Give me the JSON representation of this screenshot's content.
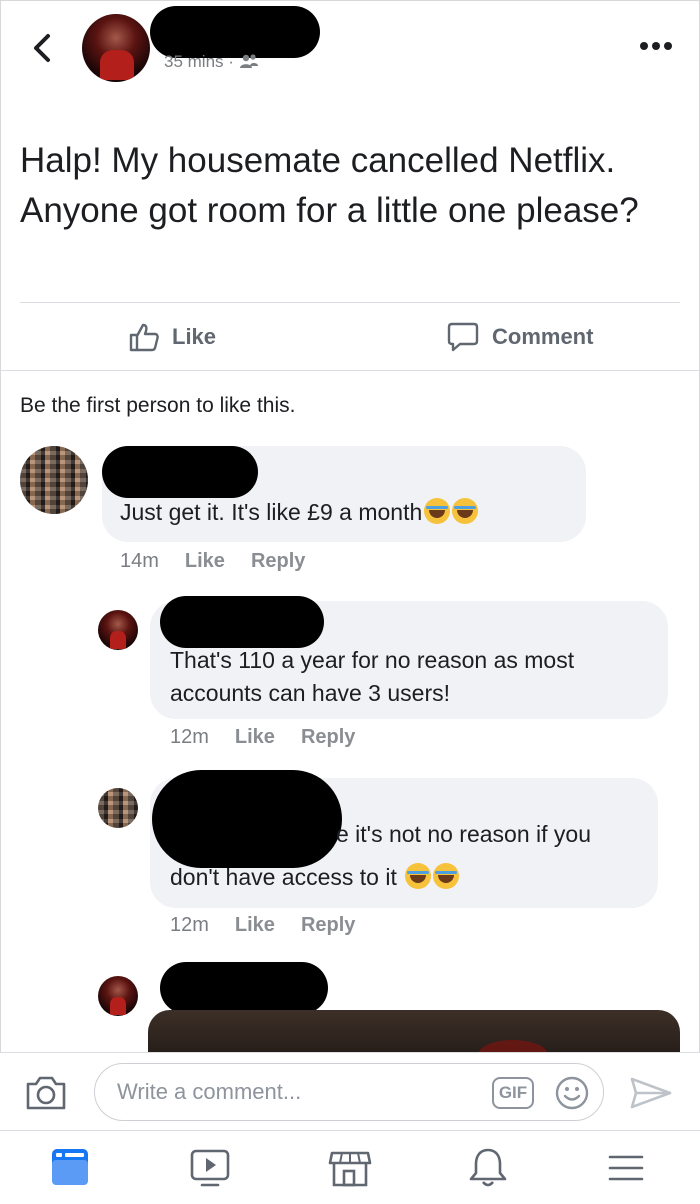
{
  "header": {
    "post_time": "35 mins",
    "meta_separator": "·",
    "audience_icon": "friends-icon",
    "back_icon": "chevron-left-icon",
    "more_icon": "ellipsis-icon"
  },
  "post": {
    "text": "Halp! My housemate cancelled Netflix. Anyone got room for a little one please?"
  },
  "actions": {
    "like_label": "Like",
    "comment_label": "Comment"
  },
  "reactions_summary": "Be the first person to like this.",
  "comments": [
    {
      "text": "Just get it. It's like £9 a month",
      "time": "14m",
      "like_label": "Like",
      "reply_label": "Reply"
    },
    {
      "text_line1": "That's 110 a year for no reason as most",
      "text_line2": "accounts can have 3 users!",
      "time": "12m",
      "like_label": "Like",
      "reply_label": "Reply"
    },
    {
      "text_line1": "e it's not no reason if you",
      "text_line2": "don't have access to it",
      "time": "12m",
      "like_label": "Like",
      "reply_label": "Reply"
    }
  ],
  "composer": {
    "placeholder": "Write a comment...",
    "gif_label": "GIF"
  },
  "nav": {
    "items": [
      "feed-icon",
      "watch-icon",
      "marketplace-icon",
      "notifications-icon",
      "menu-icon"
    ]
  },
  "colors": {
    "accent_blue": "#1877f2",
    "bubble_bg": "#f0f2f5",
    "muted_text": "#7a7d82"
  }
}
